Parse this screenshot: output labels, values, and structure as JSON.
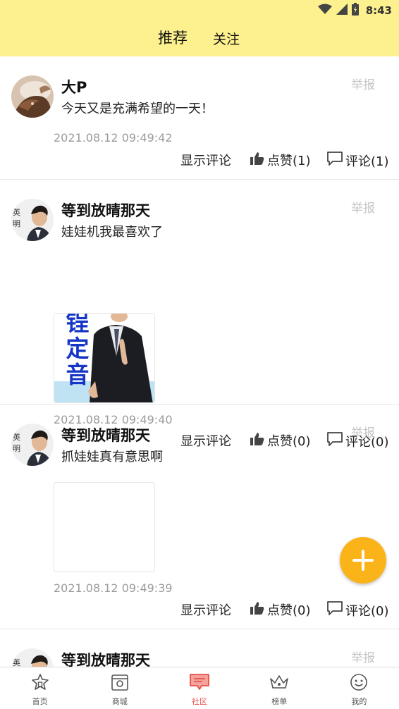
{
  "status_bar": {
    "time": "8:43",
    "icons": [
      "wifi-icon",
      "signal-icon",
      "battery-icon"
    ]
  },
  "header": {
    "tabs": [
      {
        "label": "推荐",
        "active": true
      },
      {
        "label": "关注",
        "active": false
      }
    ]
  },
  "posts": [
    {
      "username": "大P",
      "content": "今天又是充满希望的一天！",
      "timestamp": "2021.08.12 09:49:42",
      "report_label": "举报",
      "show_comments_label": "显示评论",
      "like_label": "点赞(1)",
      "comment_label": "评论(1)",
      "has_image": false
    },
    {
      "username": "等到放晴那天",
      "avatar_text": [
        "英",
        "明"
      ],
      "content": "娃娃机我最喜欢了",
      "image_text": [
        "锃",
        "定",
        "音"
      ],
      "timestamp": "2021.08.12 09:49:40",
      "report_label": "举报",
      "show_comments_label": "显示评论",
      "like_label": "点赞(0)",
      "comment_label": "评论(0)",
      "has_image": true
    },
    {
      "username": "等到放晴那天",
      "avatar_text": [
        "英",
        "明"
      ],
      "content": "抓娃娃真有意思啊",
      "timestamp": "2021.08.12 09:49:39",
      "report_label": "举报",
      "show_comments_label": "显示评论",
      "like_label": "点赞(0)",
      "comment_label": "评论(0)",
      "has_image": true
    },
    {
      "username": "等到放晴那天",
      "avatar_text": [
        "英"
      ],
      "report_label": "举报"
    }
  ],
  "fab": {
    "icon": "plus-icon",
    "color": "#fbb31a"
  },
  "bottom_nav": {
    "items": [
      {
        "label": "首页",
        "icon": "home-icon"
      },
      {
        "label": "商城",
        "icon": "shop-icon"
      },
      {
        "label": "社区",
        "icon": "community-icon",
        "active": true
      },
      {
        "label": "榜单",
        "icon": "crown-icon"
      },
      {
        "label": "我的",
        "icon": "smile-icon"
      }
    ]
  },
  "colors": {
    "header_bg": "#fdf08e",
    "accent": "#e8504a",
    "fab": "#fbb31a"
  }
}
